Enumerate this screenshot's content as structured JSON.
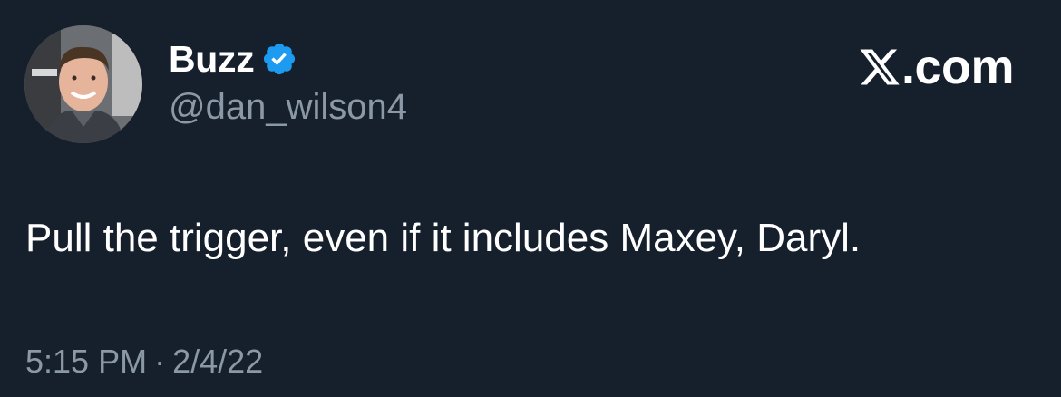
{
  "author": {
    "display_name": "Buzz",
    "handle": "@dan_wilson4",
    "verified": true,
    "verified_color": "#1d9bf0"
  },
  "brand": {
    "logo_icon": "x-logo-icon",
    "text": ".com"
  },
  "tweet": {
    "text": "Pull the trigger, even if it includes Maxey, Daryl."
  },
  "meta": {
    "time": "5:15 PM",
    "separator": "·",
    "date": "2/4/22"
  },
  "colors": {
    "background": "#161f2c",
    "primary_text": "#ffffff",
    "secondary_text": "#8b98a5"
  }
}
